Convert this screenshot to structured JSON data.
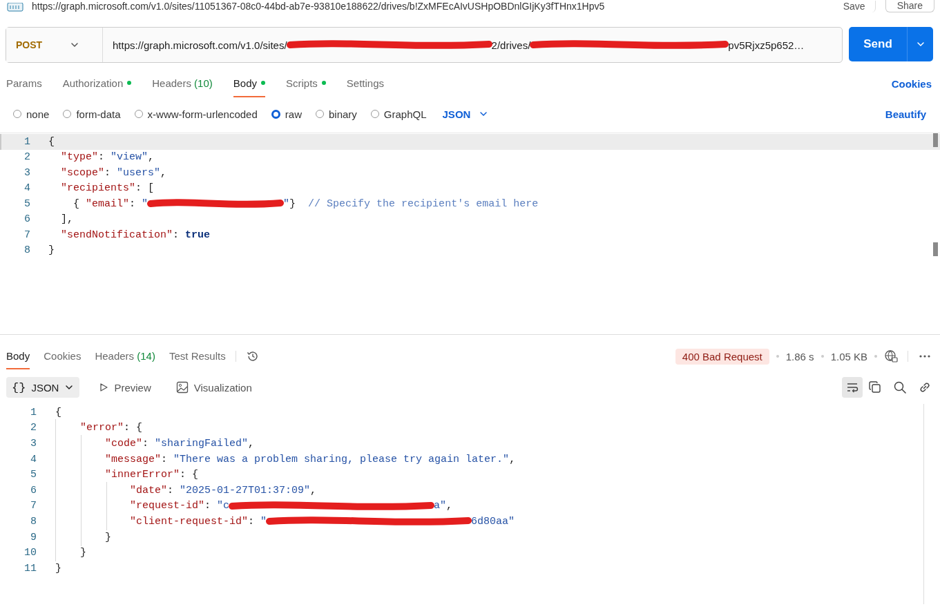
{
  "header": {
    "title": "https://graph.microsoft.com/v1.0/sites/11051367-08c0-44bd-ab7e-93810e188622/drives/b!ZxMFEcAIvUSHpOBDnlGIjKy3fTHnx1Hpv5",
    "save": "Save",
    "share": "Share"
  },
  "request": {
    "method": "POST",
    "url": [
      {
        "kind": "text",
        "text": "https://graph.microsoft.com/v1.0/sites/"
      },
      {
        "kind": "redaction"
      },
      {
        "kind": "text",
        "text": "2/drives/"
      },
      {
        "kind": "redaction"
      },
      {
        "kind": "text",
        "text": "pv5Rjxz5p652…"
      }
    ],
    "send": "Send"
  },
  "tabs": [
    {
      "label": "Params",
      "dot": false,
      "selected": false
    },
    {
      "label": "Authorization",
      "dot": true,
      "selected": false
    },
    {
      "label": "Headers",
      "count": "(10)",
      "dot": false,
      "selected": false
    },
    {
      "label": "Body",
      "dot": true,
      "selected": true
    },
    {
      "label": "Scripts",
      "dot": true,
      "selected": false
    },
    {
      "label": "Settings",
      "dot": false,
      "selected": false
    }
  ],
  "cookies_link": "Cookies",
  "body_types": [
    {
      "label": "none",
      "selected": false
    },
    {
      "label": "form-data",
      "selected": false
    },
    {
      "label": "x-www-form-urlencoded",
      "selected": false
    },
    {
      "label": "raw",
      "selected": true
    },
    {
      "label": "binary",
      "selected": false
    },
    {
      "label": "GraphQL",
      "selected": false
    }
  ],
  "format": "JSON",
  "beautify": "Beautify",
  "editor": {
    "lines": [
      {
        "number": "1",
        "highlighted": true,
        "tokens": [
          {
            "kind": "punc",
            "text": "{"
          }
        ]
      },
      {
        "number": "2",
        "highlighted": false,
        "tokens": [
          {
            "kind": "key",
            "text": "  \"type\""
          },
          {
            "kind": "punc",
            "text": ": "
          },
          {
            "kind": "str",
            "text": "\"view\""
          },
          {
            "kind": "punc",
            "text": ","
          }
        ]
      },
      {
        "number": "3",
        "highlighted": false,
        "tokens": [
          {
            "kind": "key",
            "text": "  \"scope\""
          },
          {
            "kind": "punc",
            "text": ": "
          },
          {
            "kind": "str",
            "text": "\"users\""
          },
          {
            "kind": "punc",
            "text": ","
          }
        ]
      },
      {
        "number": "4",
        "highlighted": false,
        "tokens": [
          {
            "kind": "key",
            "text": "  \"recipients\""
          },
          {
            "kind": "punc",
            "text": ": ["
          }
        ]
      },
      {
        "number": "5",
        "highlighted": false,
        "tokens": [
          {
            "kind": "punc",
            "text": "    { "
          },
          {
            "kind": "key",
            "text": "\"email\""
          },
          {
            "kind": "punc",
            "text": ": "
          },
          {
            "kind": "str",
            "text": "\""
          },
          {
            "kind": "redaction"
          },
          {
            "kind": "str",
            "text": "\""
          },
          {
            "kind": "punc",
            "text": "}  "
          },
          {
            "kind": "comment",
            "text": "// Specify the recipient's email here"
          }
        ]
      },
      {
        "number": "6",
        "highlighted": false,
        "tokens": [
          {
            "kind": "punc",
            "text": "  ],"
          }
        ]
      },
      {
        "number": "7",
        "highlighted": false,
        "tokens": [
          {
            "kind": "key",
            "text": "  \"sendNotification\""
          },
          {
            "kind": "punc",
            "text": ": "
          },
          {
            "kind": "kw",
            "text": "true"
          }
        ]
      },
      {
        "number": "8",
        "highlighted": false,
        "tokens": [
          {
            "kind": "punc",
            "text": "}"
          }
        ]
      }
    ]
  },
  "response": {
    "tabs": [
      {
        "label": "Body",
        "selected": true
      },
      {
        "label": "Cookies",
        "selected": false
      },
      {
        "label": "Headers",
        "count": "(14)",
        "selected": false
      },
      {
        "label": "Test Results",
        "selected": false
      }
    ],
    "status": "400 Bad Request",
    "time": "1.86 s",
    "size": "1.05 KB",
    "view_modes": [
      {
        "glyph": "{}",
        "label": "JSON",
        "selected": true
      },
      {
        "label": "Preview",
        "selected": false
      },
      {
        "label": "Visualization",
        "selected": false
      }
    ],
    "lines": [
      {
        "number": "1",
        "tokens": [
          {
            "kind": "punc",
            "text": "{"
          }
        ]
      },
      {
        "number": "2",
        "tokens": [
          {
            "kind": "key",
            "text": "    \"error\""
          },
          {
            "kind": "punc",
            "text": ": {"
          }
        ]
      },
      {
        "number": "3",
        "tokens": [
          {
            "kind": "key",
            "text": "        \"code\""
          },
          {
            "kind": "punc",
            "text": ": "
          },
          {
            "kind": "str",
            "text": "\"sharingFailed\""
          },
          {
            "kind": "punc",
            "text": ","
          }
        ]
      },
      {
        "number": "4",
        "tokens": [
          {
            "kind": "key",
            "text": "        \"message\""
          },
          {
            "kind": "punc",
            "text": ": "
          },
          {
            "kind": "str",
            "text": "\"There was a problem sharing, please try again later.\""
          },
          {
            "kind": "punc",
            "text": ","
          }
        ]
      },
      {
        "number": "5",
        "tokens": [
          {
            "kind": "key",
            "text": "        \"innerError\""
          },
          {
            "kind": "punc",
            "text": ": {"
          }
        ]
      },
      {
        "number": "6",
        "tokens": [
          {
            "kind": "key",
            "text": "            \"date\""
          },
          {
            "kind": "punc",
            "text": ": "
          },
          {
            "kind": "str",
            "text": "\"2025-01-27T01:37:09\""
          },
          {
            "kind": "punc",
            "text": ","
          }
        ]
      },
      {
        "number": "7",
        "tokens": [
          {
            "kind": "key",
            "text": "            \"request-id\""
          },
          {
            "kind": "punc",
            "text": ": "
          },
          {
            "kind": "str",
            "text": "\"c"
          },
          {
            "kind": "redaction"
          },
          {
            "kind": "str",
            "text": "a\""
          },
          {
            "kind": "punc",
            "text": ","
          }
        ]
      },
      {
        "number": "8",
        "tokens": [
          {
            "kind": "key",
            "text": "            \"client-request-id\""
          },
          {
            "kind": "punc",
            "text": ": "
          },
          {
            "kind": "str",
            "text": "\""
          },
          {
            "kind": "redaction"
          },
          {
            "kind": "str",
            "text": "6d80aa\""
          }
        ]
      },
      {
        "number": "9",
        "tokens": [
          {
            "kind": "punc",
            "text": "        }"
          }
        ]
      },
      {
        "number": "10",
        "tokens": [
          {
            "kind": "punc",
            "text": "    }"
          }
        ]
      },
      {
        "number": "11",
        "tokens": [
          {
            "kind": "punc",
            "text": "}"
          }
        ]
      }
    ]
  }
}
